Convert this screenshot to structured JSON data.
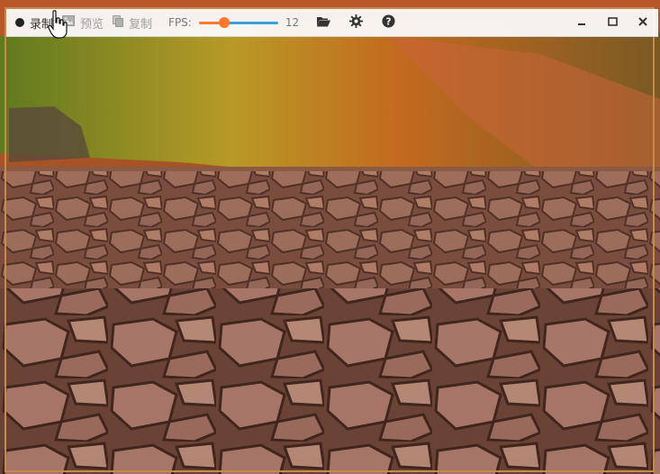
{
  "toolbar": {
    "record_label": "录制",
    "preview_label": "预览",
    "copy_label": "复制",
    "fps_label": "FPS:",
    "fps_value": "12",
    "fps_fraction": 0.32
  },
  "icons": {
    "record": "record-dot-icon",
    "preview": "image-icon",
    "copy": "copy-icon",
    "folder": "folder-open-icon",
    "settings": "gear-icon",
    "help": "question-circle-icon",
    "minimize": "minimize-icon",
    "maximize": "maximize-icon",
    "close": "close-icon",
    "cursor": "hand-cursor-icon"
  },
  "colors": {
    "slider_fill": "#ff7a30",
    "slider_track": "#3aa0de",
    "frame_border": "#c88a4a"
  }
}
